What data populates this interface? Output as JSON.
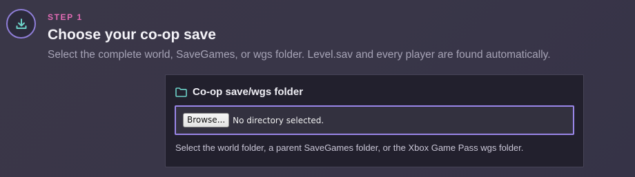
{
  "step": {
    "label": "STEP 1",
    "title": "Choose your co-op save",
    "description": "Select the complete world, SaveGames, or wgs folder. Level.sav and every player are found automatically.",
    "icon": "download-icon"
  },
  "card": {
    "icon": "folder-icon",
    "title": "Co-op save/wgs folder",
    "browse_label": "Browse...",
    "file_status": "No directory selected.",
    "help_text": "Select the world folder, a parent SaveGames folder, or the Xbox Game Pass wgs folder."
  },
  "colors": {
    "step_label": "#e26bb5",
    "accent": "#9b87ea",
    "icon_teal": "#6dd3c9"
  }
}
